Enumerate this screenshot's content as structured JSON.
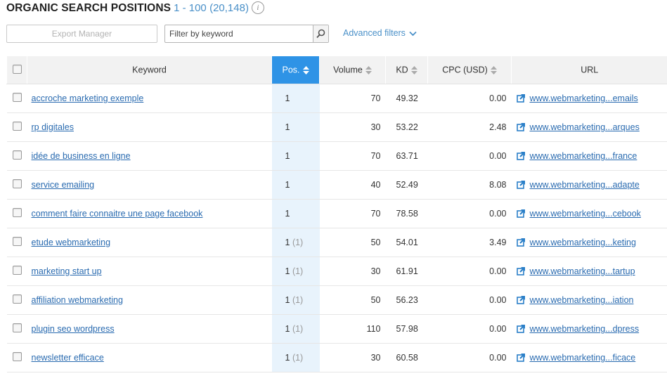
{
  "header": {
    "title": "ORGANIC SEARCH POSITIONS",
    "range": "1 - 100",
    "count": "(20,148)",
    "info_icon": "info-icon"
  },
  "toolbar": {
    "export_label": "Export Manager",
    "filter_placeholder": "Filter by keyword",
    "filter_value": "",
    "search_icon": "search-icon",
    "advanced_filters_label": "Advanced filters",
    "accent_color": "#4a90c8"
  },
  "table": {
    "columns": {
      "keyword": "Keyword",
      "pos": "Pos.",
      "volume": "Volume",
      "kd": "KD",
      "cpc": "CPC (USD)",
      "url": "URL"
    },
    "sorted_column": "Pos.",
    "sorted_color": "#2e93e6",
    "rows": [
      {
        "keyword": "accroche marketing exemple",
        "pos": "1",
        "prev": "",
        "volume": "70",
        "kd": "49.32",
        "cpc": "0.00",
        "url": "www.webmarketing...emails"
      },
      {
        "keyword": "rp digitales",
        "pos": "1",
        "prev": "",
        "volume": "30",
        "kd": "53.22",
        "cpc": "2.48",
        "url": "www.webmarketing...arques"
      },
      {
        "keyword": "idée de business en ligne",
        "pos": "1",
        "prev": "",
        "volume": "70",
        "kd": "63.71",
        "cpc": "0.00",
        "url": "www.webmarketing...france"
      },
      {
        "keyword": "service emailing",
        "pos": "1",
        "prev": "",
        "volume": "40",
        "kd": "52.49",
        "cpc": "8.08",
        "url": "www.webmarketing...adapte"
      },
      {
        "keyword": "comment faire connaitre une page facebook",
        "pos": "1",
        "prev": "",
        "volume": "70",
        "kd": "78.58",
        "cpc": "0.00",
        "url": "www.webmarketing...cebook"
      },
      {
        "keyword": "etude webmarketing",
        "pos": "1",
        "prev": "(1)",
        "volume": "50",
        "kd": "54.01",
        "cpc": "3.49",
        "url": "www.webmarketing...keting"
      },
      {
        "keyword": "marketing start up",
        "pos": "1",
        "prev": "(1)",
        "volume": "30",
        "kd": "61.91",
        "cpc": "0.00",
        "url": "www.webmarketing...tartup"
      },
      {
        "keyword": "affiliation webmarketing",
        "pos": "1",
        "prev": "(1)",
        "volume": "50",
        "kd": "56.23",
        "cpc": "0.00",
        "url": "www.webmarketing...iation"
      },
      {
        "keyword": "plugin seo wordpress",
        "pos": "1",
        "prev": "(1)",
        "volume": "110",
        "kd": "57.98",
        "cpc": "0.00",
        "url": "www.webmarketing...dpress"
      },
      {
        "keyword": "newsletter efficace",
        "pos": "1",
        "prev": "(1)",
        "volume": "30",
        "kd": "60.58",
        "cpc": "0.00",
        "url": "www.webmarketing...ficace"
      }
    ]
  }
}
